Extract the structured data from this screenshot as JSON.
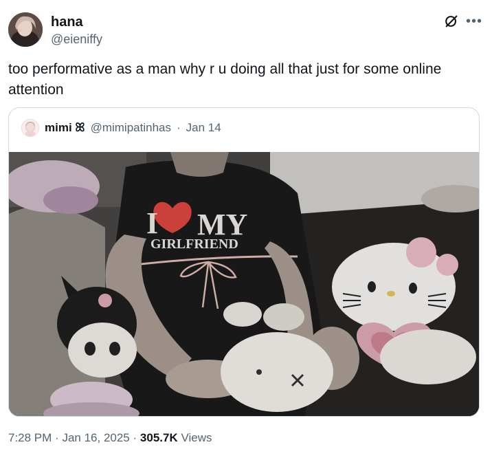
{
  "author": {
    "display_name": "hana",
    "handle": "@eieniffy"
  },
  "icons": {
    "grok": "grok-icon",
    "more": "more-horizontal-icon"
  },
  "tweet": {
    "text": "too performative as a man why r u doing all that just for some online attention"
  },
  "quote": {
    "display_name": "mimi 𖳿",
    "display_name_plain": "mimi",
    "emoji_text": "ꕤ",
    "handle": "@mimipatinhas",
    "separator": "·",
    "date": "Jan 14",
    "shirt_text_line1": "I",
    "shirt_text_line2": "MY",
    "shirt_text_line3": "GIRLFRIEND"
  },
  "meta": {
    "time": "7:28 PM",
    "sep1": "·",
    "date": "Jan 16, 2025",
    "sep2": "·",
    "views_count": "305.7K",
    "views_label": "Views"
  },
  "colors": {
    "text": "#0f1419",
    "secondary": "#536471",
    "border": "#cfd9de",
    "heart": "#e0413a"
  }
}
